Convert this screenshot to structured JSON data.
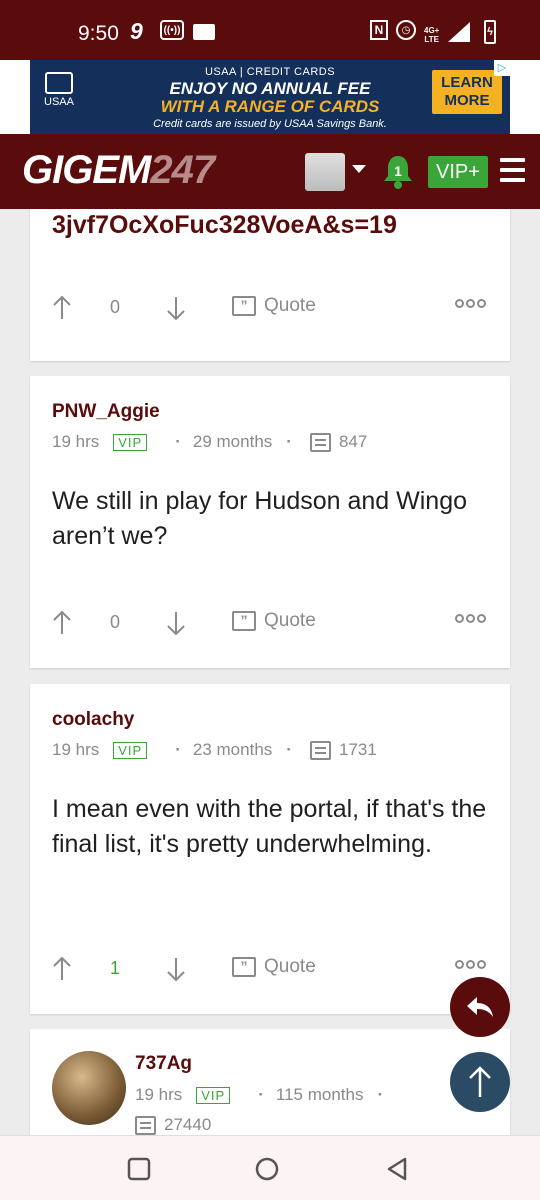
{
  "status_bar": {
    "time": "9:50",
    "network": "4G+",
    "network_sub": "LTE"
  },
  "ad": {
    "brand": "USAA",
    "subtitle": "USAA | CREDIT CARDS",
    "line1": "ENJOY NO ANNUAL FEE",
    "line2": "WITH A RANGE OF CARDS",
    "footer": "Credit cards are issued by USAA Savings Bank.",
    "cta_line1": "LEARN",
    "cta_line2": "MORE"
  },
  "header": {
    "logo_text": "GIGEM",
    "logo_number": "247",
    "notification_count": "1",
    "vip_label": "VIP+"
  },
  "posts": [
    {
      "url_tail": "3jvf7OcXoFuc328VoeA&s=19",
      "votes": "0",
      "quote_label": "Quote"
    },
    {
      "author": "PNW_Aggie",
      "time": "19 hrs",
      "vip": "VIP",
      "tenure": "29 months",
      "post_count": "847",
      "text": "We still in play for Hudson and Wingo aren’t we?",
      "votes": "0",
      "quote_label": "Quote"
    },
    {
      "author": "coolachy",
      "time": "19 hrs",
      "vip": "VIP",
      "tenure": "23 months",
      "post_count": "1731",
      "text": "I mean even with the portal, if that's the final list, it's pretty underwhelming.",
      "votes": "1",
      "quote_label": "Quote"
    },
    {
      "author": "737Ag",
      "time": "19 hrs",
      "vip": "VIP",
      "tenure": "115 months",
      "post_count": "27440"
    }
  ],
  "colors": {
    "maroon": "#5a0b0b",
    "vip_green": "#3aa63a",
    "fab_blue": "#2b4a63"
  }
}
